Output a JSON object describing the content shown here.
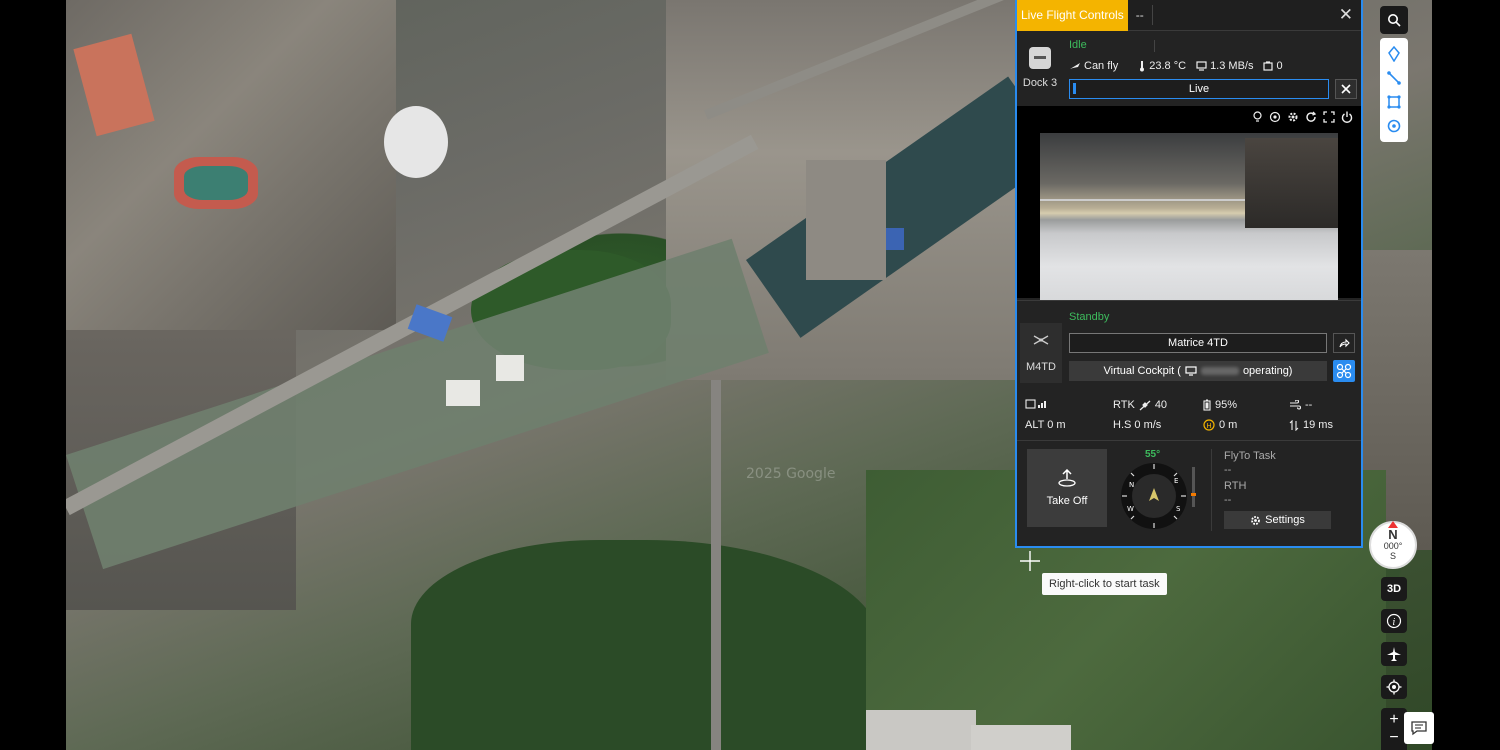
{
  "panel": {
    "tab_active": "Live Flight Controls",
    "tab_other": "--",
    "close": "✕"
  },
  "dock": {
    "name": "Dock 3",
    "status": "Idle",
    "can_fly": "Can fly",
    "temperature": "23.8 °C",
    "network": "1.3 MB/s",
    "storage": "0",
    "live_label": "Live"
  },
  "aircraft": {
    "name": "M4TD",
    "status": "Standby",
    "model": "Matrice 4TD",
    "virtual_cockpit_prefix": "Virtual Cockpit (",
    "virtual_cockpit_suffix": "operating)",
    "rtk": "RTK",
    "rtk_count": "40",
    "battery": "95%",
    "wind": "--",
    "alt": "ALT 0 m",
    "hs": "H.S 0 m/s",
    "home_dist": "0 m",
    "latency": "19 ms",
    "heading": "55°"
  },
  "controls": {
    "take_off": "Take Off",
    "flyto_label": "FlyTo Task",
    "flyto_value": "--",
    "rth_label": "RTH",
    "rth_value": "--",
    "settings": "Settings"
  },
  "map": {
    "tooltip": "Right-click to start task",
    "watermark": "2025 Google",
    "compass_dir": "N",
    "compass_deg": "000°",
    "compass_s": "S",
    "btn_3d": "3D",
    "btn_info": "i",
    "zoom_in": "+",
    "zoom_out": "−"
  },
  "colors": {
    "accent": "#2a8cf0",
    "tab_active": "#f4b400",
    "status_green": "#3dbb5d"
  }
}
